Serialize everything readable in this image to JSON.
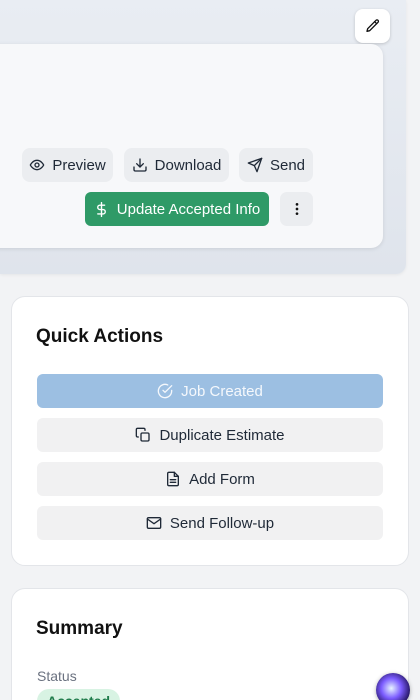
{
  "header": {
    "edit_icon": "pencil-icon"
  },
  "estimate_actions": {
    "preview_label": "Preview",
    "download_label": "Download",
    "send_label": "Send",
    "update_accepted_label": "Update Accepted Info",
    "more_icon": "vertical-dots-icon"
  },
  "quick_actions": {
    "title": "Quick Actions",
    "items": [
      {
        "label": "Job Created",
        "icon": "check-circle-icon",
        "disabled": true
      },
      {
        "label": "Duplicate Estimate",
        "icon": "copy-icon"
      },
      {
        "label": "Add Form",
        "icon": "document-icon"
      },
      {
        "label": "Send Follow-up",
        "icon": "mail-icon"
      }
    ]
  },
  "summary": {
    "title": "Summary",
    "status_label": "Status",
    "status_value": "Accepted"
  },
  "colors": {
    "accent_green": "#2f9a67",
    "disabled_blue": "#9cbfe2",
    "badge_green_bg": "#d8f3e3",
    "badge_green_text": "#1e7b4a"
  }
}
